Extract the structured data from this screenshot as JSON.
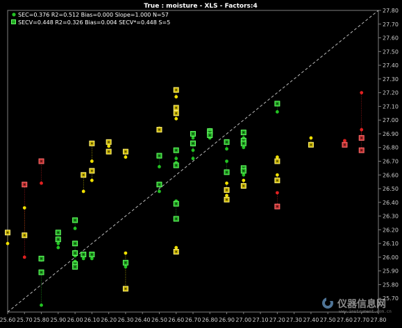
{
  "chart_data": {
    "type": "scatter",
    "title": "True : moisture - XLS - Factors:4",
    "legend": [
      {
        "symbol": "dot",
        "text": "SEC=0.376 R2=0.512 Bias=0.000 Slope=1.000 N=57"
      },
      {
        "symbol": "square",
        "text": "SECV=0.448 R2=0.326 Bias=0.004 SECV*=0.448 S=5"
      }
    ],
    "legend_position": "top-left",
    "xlim": [
      25.6,
      27.8
    ],
    "ylim": [
      25.6,
      27.8
    ],
    "x_ticks": [
      "25.60",
      "25.70",
      "25.80",
      "25.90",
      "26.00",
      "26.10",
      "26.20",
      "26.30",
      "26.40",
      "26.50",
      "26.60",
      "26.70",
      "26.80",
      "26.90",
      "27.00",
      "27.10",
      "27.20",
      "27.30",
      "27.40",
      "27.50",
      "27.60",
      "27.70",
      "27.80"
    ],
    "y_ticks": [
      "25.70",
      "25.80",
      "25.90",
      "26.00",
      "26.10",
      "26.20",
      "26.30",
      "26.40",
      "26.50",
      "26.60",
      "26.70",
      "26.80",
      "26.90",
      "27.00",
      "27.10",
      "27.20",
      "27.30",
      "27.40",
      "27.50",
      "27.60",
      "27.70",
      "27.80"
    ],
    "grid": false,
    "reference_line": "y = x",
    "colors": {
      "calibration_green": "#22c322",
      "normal_yellow": "#f0e000",
      "outlier_red": "#e02020",
      "square_fill_yellow": "#c8b400",
      "square_fill_green": "#22a822",
      "square_fill_red": "#c03030",
      "diagonal": "#bbbbbb"
    },
    "points": [
      {
        "x": 25.6,
        "ycal": 26.1,
        "ycv": 26.18,
        "c": "y"
      },
      {
        "x": 25.7,
        "ycal": 26.36,
        "ycv": 26.16,
        "c": "y"
      },
      {
        "x": 25.7,
        "ycal": 26.0,
        "ycv": 26.53,
        "c": "r"
      },
      {
        "x": 25.8,
        "ycal": 26.54,
        "ycv": 26.7,
        "c": "r"
      },
      {
        "x": 25.8,
        "ycal": 25.65,
        "ycv": 25.89,
        "c": "g"
      },
      {
        "x": 25.8,
        "ycal": 25.98,
        "ycv": 25.99,
        "c": "g"
      },
      {
        "x": 25.9,
        "ycal": 26.07,
        "ycv": 26.13,
        "c": "g"
      },
      {
        "x": 25.9,
        "ycal": 26.1,
        "ycv": 26.18,
        "c": "g"
      },
      {
        "x": 26.0,
        "ycal": 26.21,
        "ycv": 26.27,
        "c": "g"
      },
      {
        "x": 26.0,
        "ycal": 26.04,
        "ycv": 26.1,
        "c": "g"
      },
      {
        "x": 26.0,
        "ycal": 26.01,
        "ycv": 26.03,
        "c": "g"
      },
      {
        "x": 26.0,
        "ycal": 25.97,
        "ycv": 25.95,
        "c": "g"
      },
      {
        "x": 26.0,
        "ycal": 25.94,
        "ycv": 25.93,
        "c": "g"
      },
      {
        "x": 26.05,
        "ycal": 26.48,
        "ycv": 26.6,
        "c": "y"
      },
      {
        "x": 26.05,
        "ycal": 25.99,
        "ycv": 26.02,
        "c": "g"
      },
      {
        "x": 26.1,
        "ycal": 26.7,
        "ycv": 26.83,
        "c": "y"
      },
      {
        "x": 26.1,
        "ycal": 26.56,
        "ycv": 26.63,
        "c": "y"
      },
      {
        "x": 26.1,
        "ycal": 25.99,
        "ycv": 26.02,
        "c": "g"
      },
      {
        "x": 26.2,
        "ycal": 26.81,
        "ycv": 26.84,
        "c": "y"
      },
      {
        "x": 26.2,
        "ycal": 26.77,
        "ycv": 26.77,
        "c": "y"
      },
      {
        "x": 26.3,
        "ycal": 26.73,
        "ycv": 26.77,
        "c": "y"
      },
      {
        "x": 26.3,
        "ycal": 26.03,
        "ycv": 25.77,
        "c": "y"
      },
      {
        "x": 26.3,
        "ycal": 25.93,
        "ycv": 25.96,
        "c": "g"
      },
      {
        "x": 26.5,
        "ycal": 26.94,
        "ycv": 26.93,
        "c": "y"
      },
      {
        "x": 26.5,
        "ycal": 26.66,
        "ycv": 26.74,
        "c": "g"
      },
      {
        "x": 26.5,
        "ycal": 26.48,
        "ycv": 26.53,
        "c": "g"
      },
      {
        "x": 26.6,
        "ycal": 27.17,
        "ycv": 27.22,
        "c": "y"
      },
      {
        "x": 26.6,
        "ycal": 27.06,
        "ycv": 27.09,
        "c": "y"
      },
      {
        "x": 26.6,
        "ycal": 27.01,
        "ycv": 27.05,
        "c": "y"
      },
      {
        "x": 26.6,
        "ycal": 26.72,
        "ycv": 26.78,
        "c": "g"
      },
      {
        "x": 26.6,
        "ycal": 26.69,
        "ycv": 26.67,
        "c": "g"
      },
      {
        "x": 26.6,
        "ycal": 26.41,
        "ycv": 26.39,
        "c": "g"
      },
      {
        "x": 26.6,
        "ycal": 26.4,
        "ycv": 26.28,
        "c": "g"
      },
      {
        "x": 26.6,
        "ycal": 26.07,
        "ycv": 26.04,
        "c": "y"
      },
      {
        "x": 26.7,
        "ycal": 26.87,
        "ycv": 26.9,
        "c": "g"
      },
      {
        "x": 26.7,
        "ycal": 26.78,
        "ycv": 26.83,
        "c": "g"
      },
      {
        "x": 26.7,
        "ycal": 26.72,
        "ycv": 26.83,
        "c": "g"
      },
      {
        "x": 26.8,
        "ycal": 26.93,
        "ycv": 26.92,
        "c": "g"
      },
      {
        "x": 26.8,
        "ycal": 26.9,
        "ycv": 26.91,
        "c": "g"
      },
      {
        "x": 26.8,
        "ycal": 26.87,
        "ycv": 26.89,
        "c": "g"
      },
      {
        "x": 26.9,
        "ycal": 26.79,
        "ycv": 26.84,
        "c": "g"
      },
      {
        "x": 26.9,
        "ycal": 26.7,
        "ycv": 26.62,
        "c": "g"
      },
      {
        "x": 26.9,
        "ycal": 26.54,
        "ycv": 26.49,
        "c": "y"
      },
      {
        "x": 26.9,
        "ycal": 26.45,
        "ycv": 26.42,
        "c": "y"
      },
      {
        "x": 27.0,
        "ycal": 26.87,
        "ycv": 26.91,
        "c": "g"
      },
      {
        "x": 27.0,
        "ycal": 26.83,
        "ycv": 26.85,
        "c": "g"
      },
      {
        "x": 27.0,
        "ycal": 26.8,
        "ycv": 26.83,
        "c": "g"
      },
      {
        "x": 27.0,
        "ycal": 26.64,
        "ycv": 26.65,
        "c": "g"
      },
      {
        "x": 27.0,
        "ycal": 26.6,
        "ycv": 26.63,
        "c": "g"
      },
      {
        "x": 27.0,
        "ycal": 26.56,
        "ycv": 26.52,
        "c": "y"
      },
      {
        "x": 27.2,
        "ycal": 27.06,
        "ycv": 27.12,
        "c": "g"
      },
      {
        "x": 27.2,
        "ycal": 26.73,
        "ycv": 26.7,
        "c": "y"
      },
      {
        "x": 27.2,
        "ycal": 26.6,
        "ycv": 26.56,
        "c": "y"
      },
      {
        "x": 27.2,
        "ycal": 26.47,
        "ycv": 26.37,
        "c": "r"
      },
      {
        "x": 27.4,
        "ycal": 26.87,
        "ycv": 26.82,
        "c": "y"
      },
      {
        "x": 27.6,
        "ycal": 26.85,
        "ycv": 26.82,
        "c": "r"
      },
      {
        "x": 27.7,
        "ycal": 27.2,
        "ycv": 26.87,
        "c": "r"
      },
      {
        "x": 27.7,
        "ycal": 26.93,
        "ycv": 26.78,
        "c": "r"
      }
    ]
  },
  "watermark": {
    "name": "仪器信息网",
    "url": "www.instrument.com.cn"
  }
}
